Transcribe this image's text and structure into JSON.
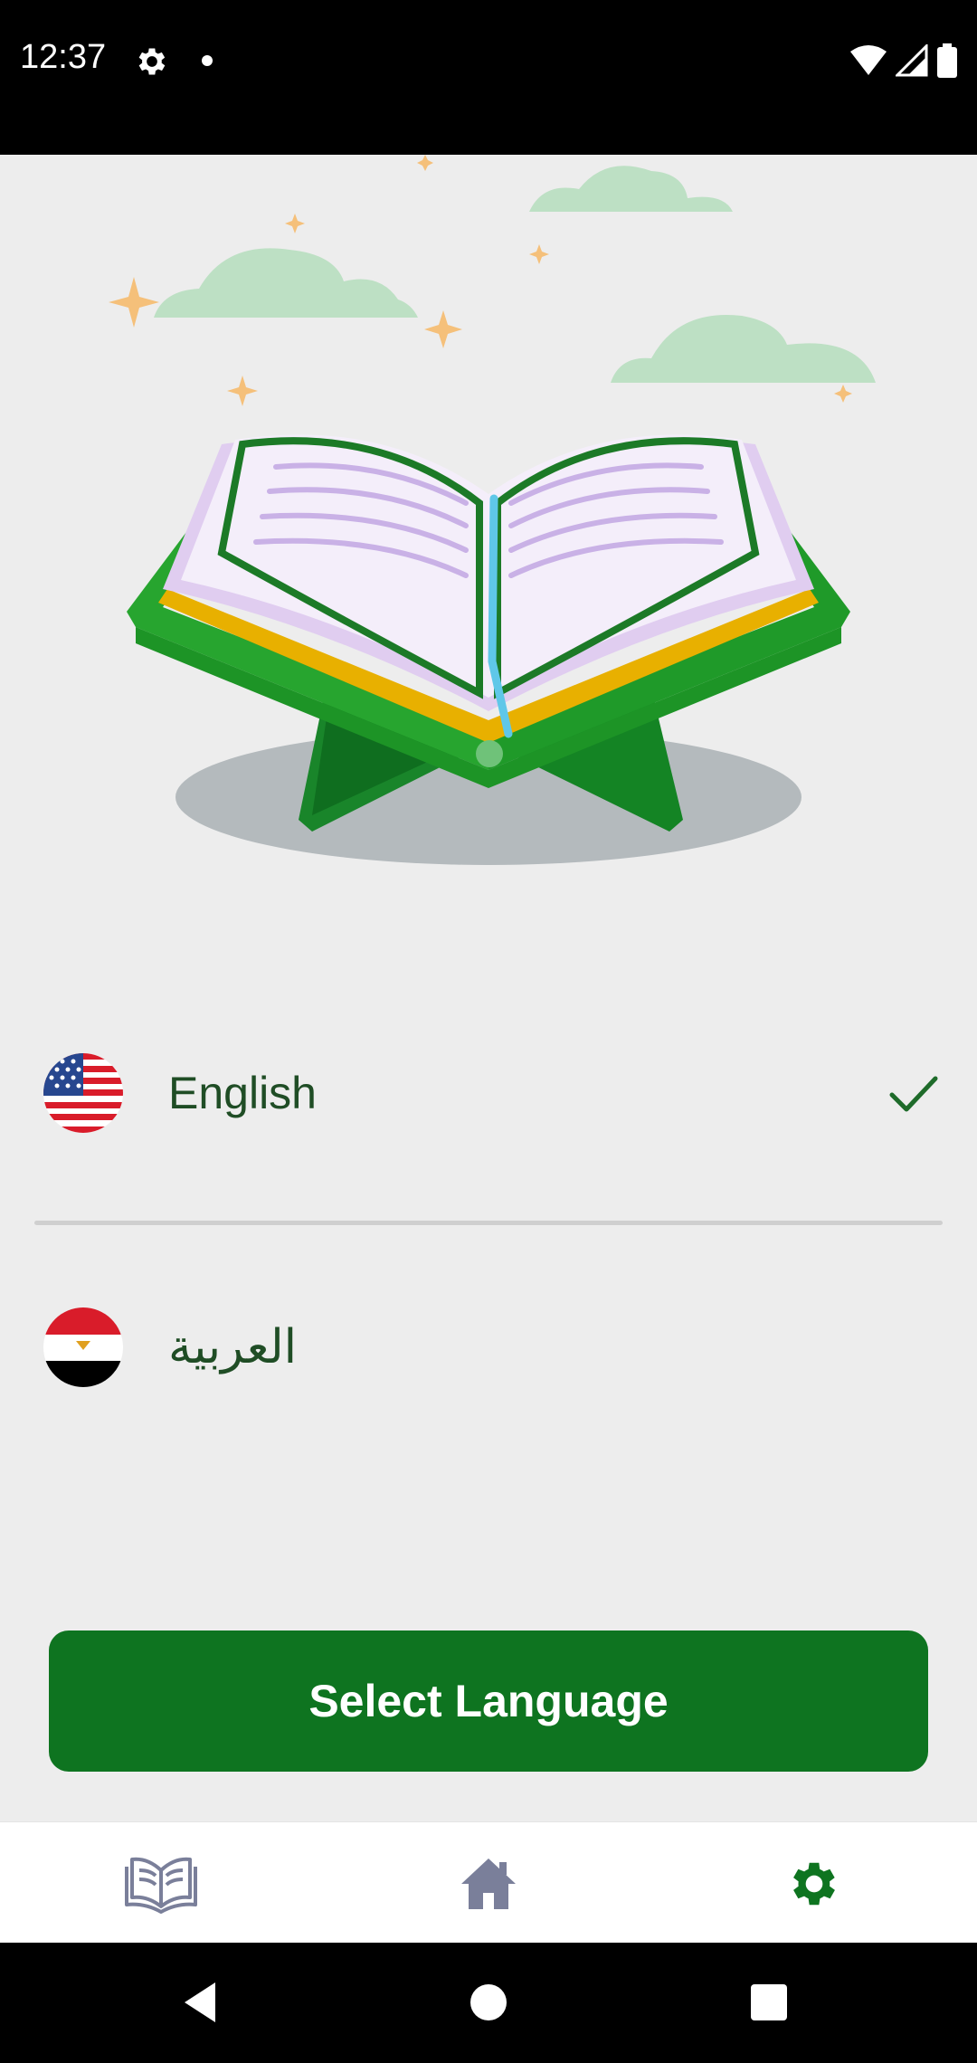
{
  "status_bar": {
    "time": "12:37",
    "icons": [
      "gear-icon",
      "notification-dot",
      "wifi-icon",
      "signal-icon",
      "battery-icon"
    ]
  },
  "hero": {
    "illustration": "quran-on-stand-illustration"
  },
  "languages": [
    {
      "label": "English",
      "flag": "us-flag-icon",
      "selected": true
    },
    {
      "label": "العربية",
      "flag": "egypt-flag-icon",
      "selected": false
    }
  ],
  "select_button": {
    "label": "Select Language"
  },
  "bottom_nav": {
    "items": [
      {
        "icon": "open-book-icon",
        "active": false
      },
      {
        "icon": "home-icon",
        "active": false
      },
      {
        "icon": "gear-icon",
        "active": true
      }
    ]
  },
  "system_nav": {
    "icons": [
      "back-icon",
      "home-circle-icon",
      "recents-icon"
    ]
  },
  "colors": {
    "primary_green": "#0e7420",
    "label_green": "#1f4d25",
    "background": "#ededed",
    "nav_inactive": "#7a7f9a"
  }
}
